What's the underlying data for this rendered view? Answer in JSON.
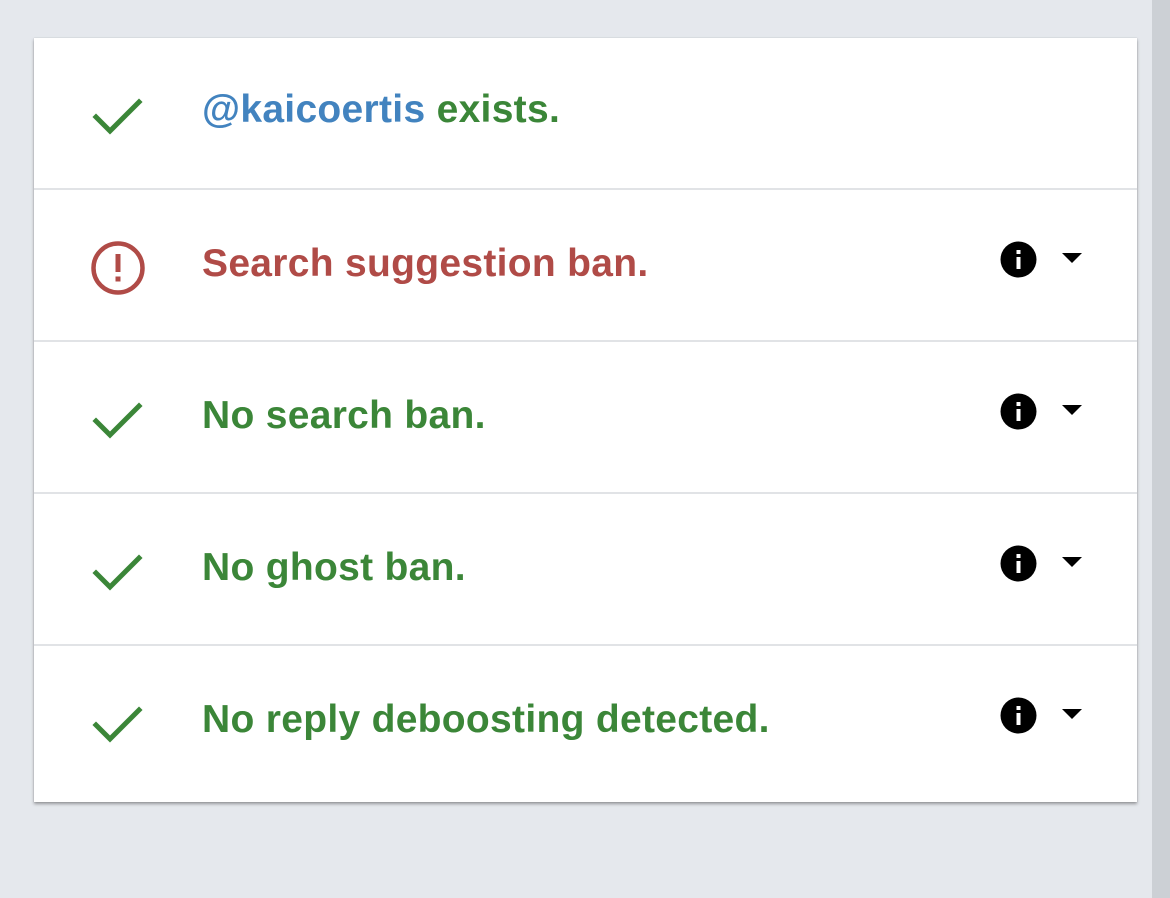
{
  "colors": {
    "success": "#3b8638",
    "failure": "#b04b47",
    "handle": "#4283bf",
    "background": "#e5e8ed",
    "card": "#ffffff"
  },
  "results": [
    {
      "status": "ok",
      "icon": "check-icon",
      "handle": "@kaicoertis",
      "text": " exists.",
      "has_details": false
    },
    {
      "status": "bad",
      "icon": "alert-circle-icon",
      "text": "Search suggestion ban.",
      "has_details": true,
      "details_icons": [
        "info-icon",
        "caret-down-icon"
      ]
    },
    {
      "status": "ok",
      "icon": "check-icon",
      "text": "No search ban.",
      "has_details": true,
      "details_icons": [
        "info-icon",
        "caret-down-icon"
      ]
    },
    {
      "status": "ok",
      "icon": "check-icon",
      "text": "No ghost ban.",
      "has_details": true,
      "details_icons": [
        "info-icon",
        "caret-down-icon"
      ]
    },
    {
      "status": "ok",
      "icon": "check-icon",
      "text": "No reply deboosting detected.",
      "has_details": true,
      "details_icons": [
        "info-icon",
        "caret-down-icon"
      ]
    }
  ]
}
